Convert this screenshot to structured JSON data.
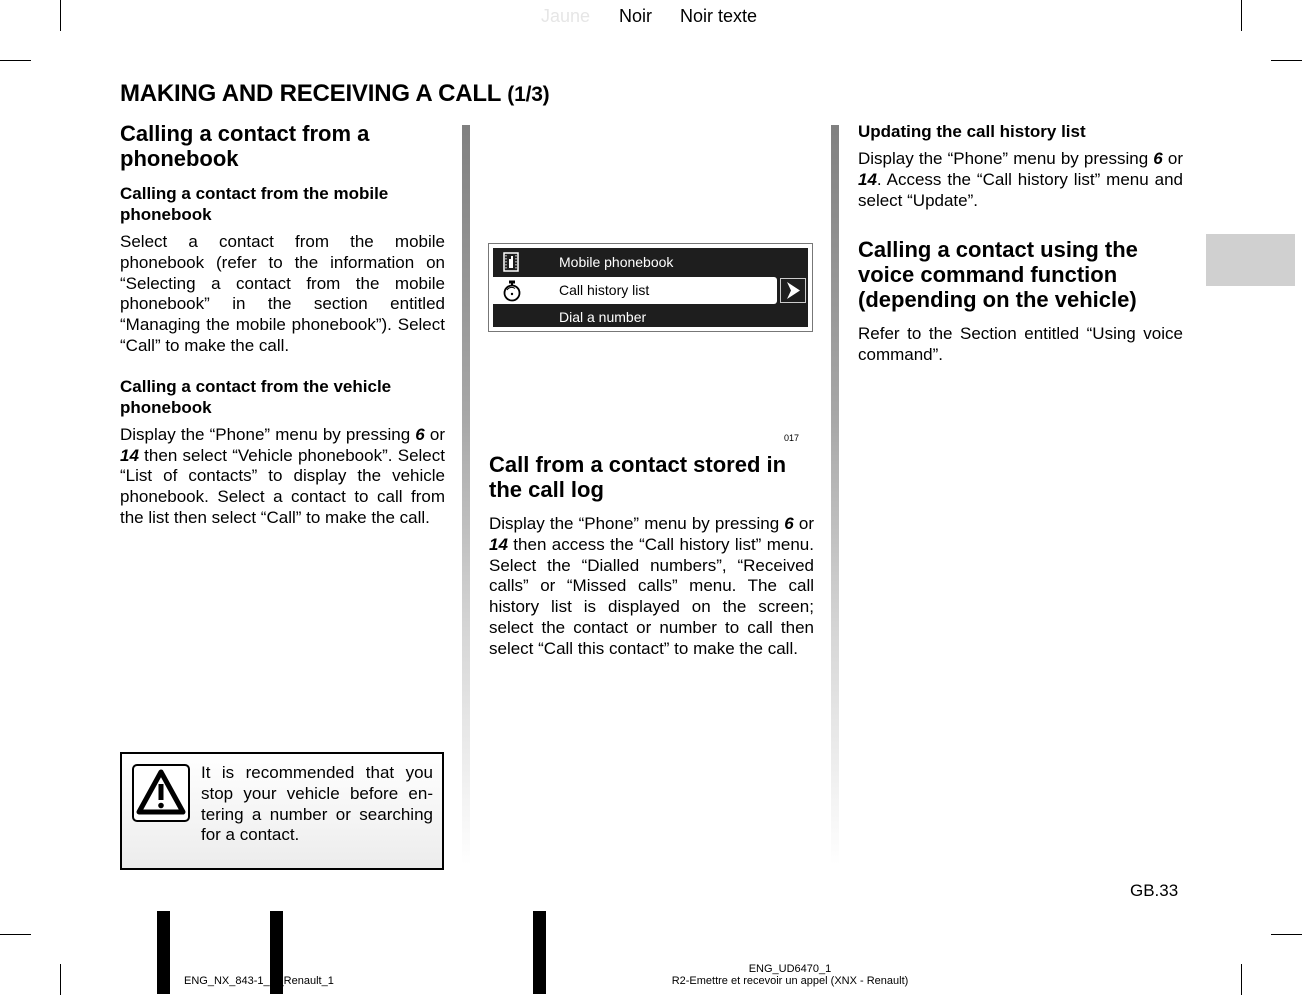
{
  "separations": {
    "jaune": "Jaune",
    "noir": "Noir",
    "noir_texte": "Noir texte"
  },
  "page_title": {
    "main": "MAKING AND RECEIVING A CALL",
    "suffix": "(1/3)"
  },
  "column1": {
    "heading": "Calling a contact from a phonebook",
    "section1": {
      "subheading": "Calling a contact from the mobile phonebook",
      "text": "Select a contact from the mobile phonebook (refer to the information on “Selecting a contact from the mobile phonebook” in the section entitled “Managing the mobile phonebook”). Select “Call” to make the call."
    },
    "section2": {
      "subheading": "Calling a contact from the vehicle phonebook",
      "text_a": "Display the “Phone” menu by press­ing ",
      "key1": "6",
      "text_b": " or ",
      "key2": "14",
      "text_c": " then select “Vehicle phone­book”. Select “List of contacts” to dis­play the vehicle phonebook. Select a contact to call from the list then select “Call” to make the call."
    },
    "warning": {
      "icon": "warning-triangle-icon",
      "text": "It is recommended that you stop your vehicle before en­tering a number or search­ing for a contact."
    }
  },
  "screen_image": {
    "menu_items": [
      {
        "label": "Mobile phonebook",
        "icon": "phonebook-icon",
        "selected": false
      },
      {
        "label": "Call history list",
        "icon": "stopwatch-icon",
        "selected": true
      },
      {
        "label": "Dial a number",
        "icon": "",
        "selected": false
      }
    ],
    "arrow": "chevron-right-icon",
    "ref": "017"
  },
  "column2": {
    "heading": "Call from a contact stored in the call log",
    "text_a": "Display the “Phone” menu by press­ing ",
    "key1": "6",
    "text_b": " or ",
    "key2": "14",
    "text_c": " then access the “Call his­tory list” menu. Select the “Dialled numbers”, “Received calls” or “Missed calls” menu. The call history list is dis­played on the screen; select the contact or number to call then select “Call this contact” to make the call."
  },
  "column3": {
    "subheading": "Updating the call history list",
    "text_a": "Display the “Phone” menu by press­ing ",
    "key1": "6",
    "text_b": " or ",
    "key2": "14",
    "text_c": ". Access the “Call history list” menu and select “Update”.",
    "heading2": "Calling a contact using the voice command function (depending on the vehicle)",
    "text2": "Refer to the Section entitled “Using voice command”."
  },
  "page_number": "GB.33",
  "footer": {
    "left": "ENG_NX_843-1_N",
    "left_tail": "_Renault_1",
    "right_line1": "ENG_UD6470_1",
    "right_line2": "R2-Emettre et recevoir un appel (XNX - Renault)"
  }
}
